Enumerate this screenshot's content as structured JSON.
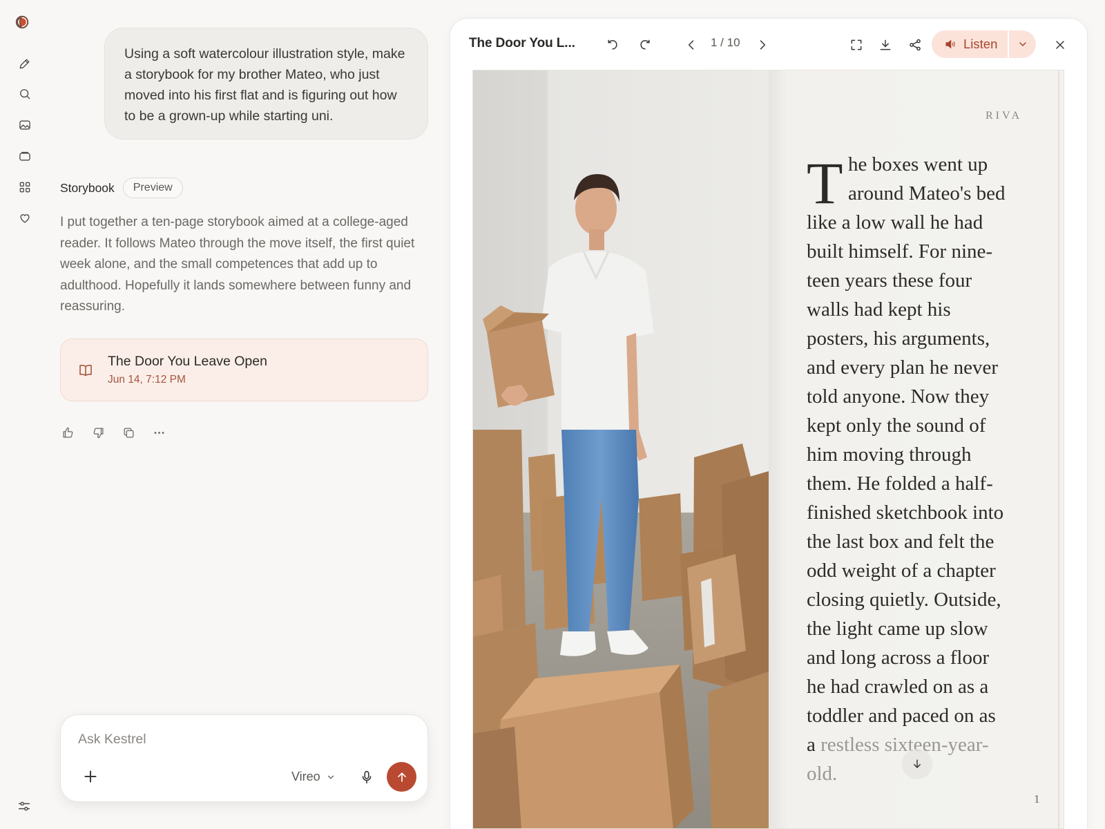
{
  "user_message": "Using a soft watercolour illustration style, make a storybook for my brother Mateo, who just moved into his first flat and is figuring out how to be a grown-up while starting uni.",
  "assistant": {
    "label": "Storybook",
    "preview_label": "Preview",
    "text": "I put together a ten-page storybook aimed at a college-aged reader. It follows Mateo through the move itself, the first quiet week alone, and the small competences that add up to adulthood. Hopefully it lands somewhere between funny and reassuring.",
    "card": {
      "title": "The Door You Leave Open",
      "date": "Jun 14, 7:12 PM"
    }
  },
  "composer": {
    "placeholder": "Ask Kestrel",
    "model": "Vireo"
  },
  "viewer": {
    "title": "The Door You L...",
    "pager": "1 / 10",
    "listen_label": "Listen",
    "author": "RIVA",
    "dropcap": "T",
    "lines": [
      "he boxes went up",
      "around Mateo's bed",
      "like a low wall he had",
      "built himself. For nine-",
      "teen years these four",
      "walls had kept his",
      "posters, his arguments,",
      "and every plan he never",
      "told anyone. Now they",
      "kept only the sound of",
      "him moving through",
      "them. He folded a half-",
      "finished sketchbook into",
      "the last box and felt the",
      "odd weight of a chapter",
      "closing quietly. Outside,",
      "the light came up slow",
      "and long across a floor",
      "he had crawled on as a",
      "toddler and paced on as"
    ],
    "last_line_start": "a ",
    "last_line_faded": "restless sixteen-year-",
    "final_line": "old.",
    "page_number": "1"
  },
  "colors": {
    "accent": "#b94a31",
    "card_bg": "#fbeee8",
    "listen_bg": "#fbe3da"
  },
  "icons": [
    "logo-icon",
    "new-chat-icon",
    "search-icon",
    "image-icon",
    "folder-icon",
    "apps-icon",
    "heart-icon",
    "settings-icon",
    "thumbs-up-icon",
    "thumbs-down-icon",
    "copy-icon",
    "more-icon",
    "book-icon",
    "undo-icon",
    "redo-icon",
    "chevron-left-icon",
    "chevron-right-icon",
    "fullscreen-icon",
    "download-icon",
    "share-icon",
    "speaker-icon",
    "chevron-down-icon",
    "close-icon",
    "plus-icon",
    "mic-icon",
    "send-icon",
    "arrow-down-icon"
  ]
}
